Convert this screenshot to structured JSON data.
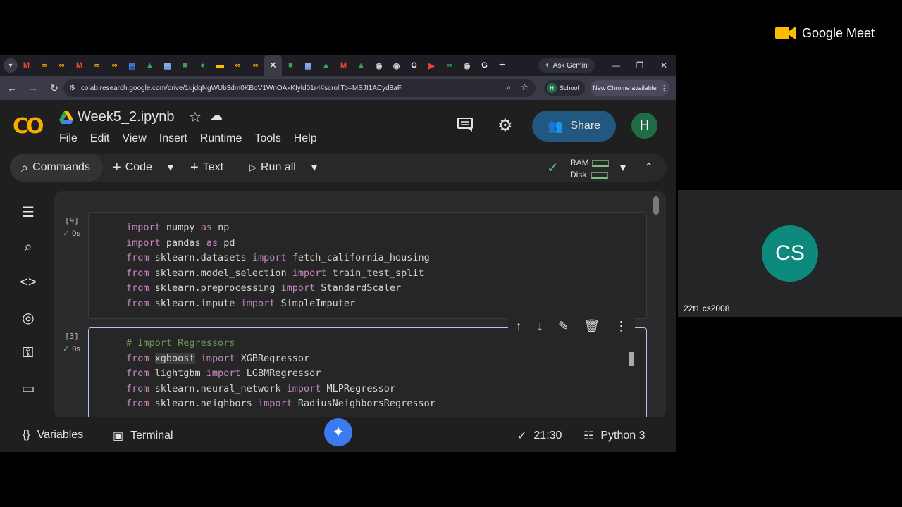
{
  "browser": {
    "tabs": [
      {
        "icon": "gmail-icon",
        "glyph": "M",
        "color": "#ea4335"
      },
      {
        "icon": "infinity-icon",
        "glyph": "∞",
        "color": "#f9ab00"
      },
      {
        "icon": "infinity-icon",
        "glyph": "∞",
        "color": "#f9ab00"
      },
      {
        "icon": "gmail-icon",
        "glyph": "M",
        "color": "#ea4335"
      },
      {
        "icon": "infinity-icon",
        "glyph": "∞",
        "color": "#f9ab00"
      },
      {
        "icon": "infinity-icon",
        "glyph": "∞",
        "color": "#f9ab00"
      },
      {
        "icon": "docs-icon",
        "glyph": "▤",
        "color": "#4285f4"
      },
      {
        "icon": "drive-icon",
        "glyph": "▲",
        "color": "#34a853"
      },
      {
        "icon": "forms-icon",
        "glyph": "▦",
        "color": "#8ab4f8"
      },
      {
        "icon": "meet-icon",
        "glyph": "■",
        "color": "#34a853"
      },
      {
        "icon": "chat-icon",
        "glyph": "●",
        "color": "#34a853"
      },
      {
        "icon": "slides-icon",
        "glyph": "▬",
        "color": "#fbbc04"
      },
      {
        "icon": "infinity-icon",
        "glyph": "∞",
        "color": "#f9ab00"
      },
      {
        "icon": "infinity-icon",
        "glyph": "∞",
        "color": "#f9ab00"
      }
    ],
    "tabs_after": [
      {
        "icon": "meet-icon",
        "glyph": "■",
        "color": "#34a853"
      },
      {
        "icon": "forms-icon",
        "glyph": "▦",
        "color": "#8ab4f8"
      },
      {
        "icon": "drive-icon",
        "glyph": "▲",
        "color": "#34a853"
      },
      {
        "icon": "gmail-icon",
        "glyph": "M",
        "color": "#ea4335"
      },
      {
        "icon": "drive-icon",
        "glyph": "▲",
        "color": "#34a853"
      },
      {
        "icon": "globe-icon",
        "glyph": "◉",
        "color": "#cccccc"
      },
      {
        "icon": "globe-icon",
        "glyph": "◉",
        "color": "#cccccc"
      },
      {
        "icon": "google-icon",
        "glyph": "G",
        "color": "#ffffff"
      },
      {
        "icon": "youtube-icon",
        "glyph": "▶",
        "color": "#ea4335"
      },
      {
        "icon": "infinity-icon",
        "glyph": "∞",
        "color": "#34a853"
      },
      {
        "icon": "globe-icon",
        "glyph": "◉",
        "color": "#cccccc"
      },
      {
        "icon": "google-icon",
        "glyph": "G",
        "color": "#ffffff"
      }
    ],
    "ask_gemini": "Ask Gemini",
    "url": "colab.research.google.com/drive/1ujdqNgWUb3dm0KBoV1WnOAkKIyld01r4#scrollTo=MSJI1ACyd8aF",
    "profile_label": "School",
    "profile_initial": "H",
    "new_chrome": "New Chrome available"
  },
  "colab": {
    "logo": "CO",
    "notebook_title": "Week5_2.ipynb",
    "menu": [
      "File",
      "Edit",
      "View",
      "Insert",
      "Runtime",
      "Tools",
      "Help"
    ],
    "share_label": "Share",
    "user_initial": "H",
    "toolbar": {
      "commands": "Commands",
      "code": "Code",
      "text": "Text",
      "run_all": "Run all",
      "ram": "RAM",
      "disk": "Disk"
    },
    "cells": [
      {
        "exec_count": "[9]",
        "exec_time": "0s",
        "lines": [
          [
            {
              "t": "import",
              "k": "kw"
            },
            {
              "t": " numpy "
            },
            {
              "t": "as",
              "k": "kw"
            },
            {
              "t": " np"
            }
          ],
          [
            {
              "t": "import",
              "k": "kw"
            },
            {
              "t": " pandas "
            },
            {
              "t": "as",
              "k": "kw"
            },
            {
              "t": " pd"
            }
          ],
          [
            {
              "t": "from",
              "k": "kw"
            },
            {
              "t": " sklearn.datasets "
            },
            {
              "t": "import",
              "k": "kw"
            },
            {
              "t": " fetch_california_housing"
            }
          ],
          [
            {
              "t": "from",
              "k": "kw"
            },
            {
              "t": " sklearn.model_selection "
            },
            {
              "t": "import",
              "k": "kw"
            },
            {
              "t": " train_test_split"
            }
          ],
          [
            {
              "t": "from",
              "k": "kw"
            },
            {
              "t": " sklearn.preprocessing "
            },
            {
              "t": "import",
              "k": "kw"
            },
            {
              "t": " StandardScaler"
            }
          ],
          [
            {
              "t": "from",
              "k": "kw"
            },
            {
              "t": " sklearn.impute "
            },
            {
              "t": "import",
              "k": "kw"
            },
            {
              "t": " SimpleImputer"
            }
          ]
        ]
      },
      {
        "exec_count": "[3]",
        "exec_time": "0s",
        "lines": [
          [
            {
              "t": "# Import Regressors",
              "k": "cm"
            }
          ],
          [
            {
              "t": "from",
              "k": "kw"
            },
            {
              "t": " "
            },
            {
              "t": "xgboost",
              "k": "hl"
            },
            {
              "t": " "
            },
            {
              "t": "import",
              "k": "kw"
            },
            {
              "t": " XGBRegressor"
            }
          ],
          [
            {
              "t": "from",
              "k": "kw"
            },
            {
              "t": " lightgbm "
            },
            {
              "t": "import",
              "k": "kw"
            },
            {
              "t": " LGBMRegressor"
            }
          ],
          [
            {
              "t": "from",
              "k": "kw"
            },
            {
              "t": " sklearn.neural_network "
            },
            {
              "t": "import",
              "k": "kw"
            },
            {
              "t": " MLPRegressor"
            }
          ],
          [
            {
              "t": "from",
              "k": "kw"
            },
            {
              "t": " sklearn.neighbors "
            },
            {
              "t": "import",
              "k": "kw"
            },
            {
              "t": " RadiusNeighborsRegressor"
            }
          ]
        ]
      }
    ],
    "statusbar": {
      "variables": "Variables",
      "terminal": "Terminal",
      "time": "21:30",
      "runtime": "Python 3"
    }
  },
  "meet": {
    "brand": "Google Meet",
    "participant_initials": "CS",
    "participant_name": "22t1 cs2008"
  }
}
